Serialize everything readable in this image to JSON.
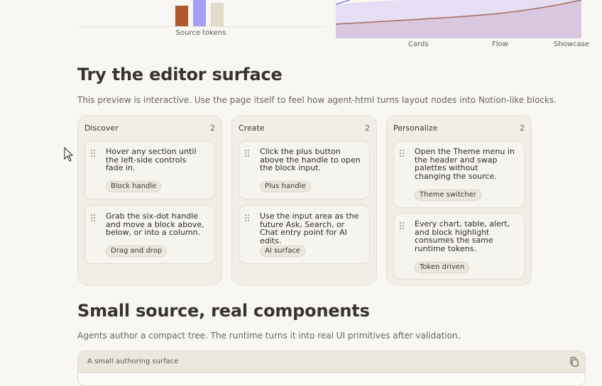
{
  "colors": {
    "bar1": "#b0572d",
    "bar2": "#a79cf7",
    "bar3": "#e2dbc9",
    "area_fill": "#d8c6e0",
    "area_line": "#a26a5e",
    "area_top_line": "#8b7fe8",
    "area_upper_fill": "#e4dcf5"
  },
  "top_chart": {
    "bar_label": "Source tokens",
    "bars": [
      {
        "value": 0.78,
        "color": "#b0572d"
      },
      {
        "value": 1.0,
        "color": "#a79cf7"
      },
      {
        "value": 0.9,
        "color": "#e2dbc9"
      }
    ],
    "area_labels": [
      "Cards",
      "Flow",
      "Showcase"
    ]
  },
  "section1": {
    "title": "Try the editor surface",
    "description": "This preview is interactive. Use the page itself to feel how agent-html turns layout nodes into Notion-like blocks."
  },
  "board": {
    "columns": [
      {
        "title": "Discover",
        "count": "2",
        "cards": [
          {
            "text": "Hover any section until the left-side controls fade in.",
            "chip": "Block handle"
          },
          {
            "text": "Grab the six-dot handle and move a block above, below, or into a column.",
            "chip": "Drag and drop"
          }
        ]
      },
      {
        "title": "Create",
        "count": "2",
        "cards": [
          {
            "text": "Click the plus button above the handle to open the block input.",
            "chip": "Plus handle"
          },
          {
            "text": "Use the input area as the future Ask, Search, or Chat entry point for AI edits.",
            "chip": "AI surface"
          }
        ]
      },
      {
        "title": "Personalize",
        "count": "2",
        "cards": [
          {
            "text": "Open the Theme menu in the header and swap palettes without changing the source.",
            "chip": "Theme switcher"
          },
          {
            "text": "Every chart, table, alert, and block highlight consumes the same runtime tokens.",
            "chip": "Token driven"
          }
        ]
      }
    ]
  },
  "section2": {
    "title": "Small source, real components",
    "description": "Agents author a compact tree. The runtime turns it into real UI primitives after validation."
  },
  "source_panel": {
    "title": "A small authoring surface"
  },
  "icons": {
    "copy": "copy-icon",
    "grip": "drag-handle-icon",
    "cursor": "mouse-cursor-icon"
  }
}
